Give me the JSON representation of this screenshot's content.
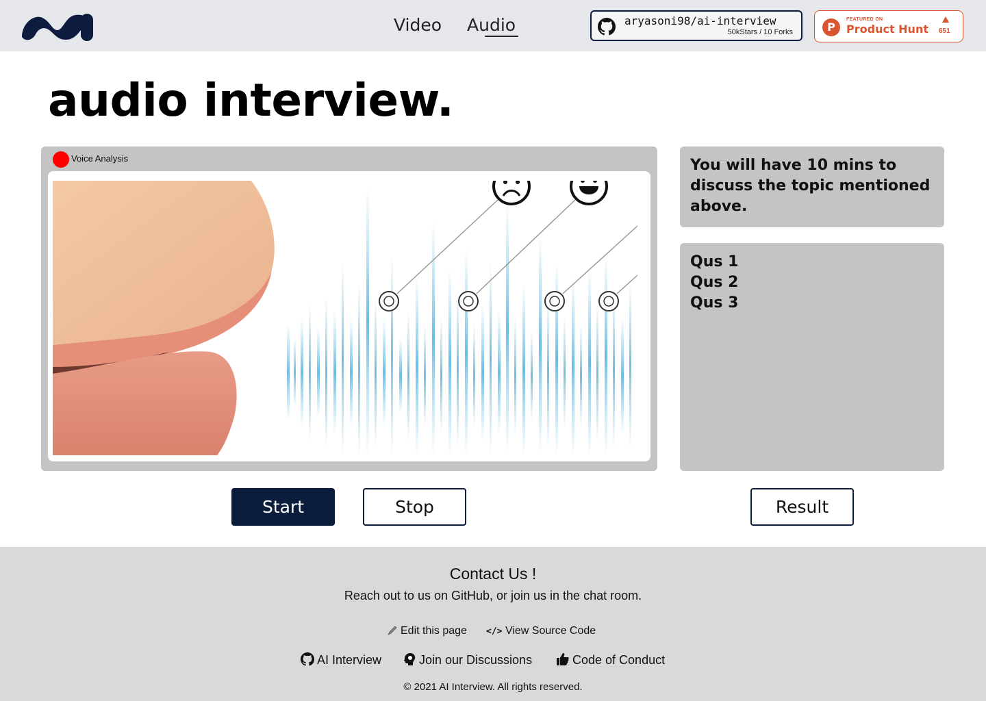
{
  "header": {
    "nav": {
      "video": "Video",
      "audio": "Audio"
    },
    "github_badge": {
      "repo": "aryasoni98/ai-interview",
      "stats": "50kStars / 10 Forks"
    },
    "product_hunt": {
      "featured": "FEATURED ON",
      "name": "Product Hunt",
      "count": "651",
      "brand_color": "#da552f"
    }
  },
  "page": {
    "title": "audio interview."
  },
  "voice_panel": {
    "label": "Voice Analysis",
    "indicator_color": "#ff0000"
  },
  "info_card": {
    "text": "You will have 10 mins to discuss the topic mentioned above."
  },
  "questions": [
    "Qus 1",
    "Qus 2",
    "Qus 3"
  ],
  "buttons": {
    "start": "Start",
    "stop": "Stop",
    "result": "Result"
  },
  "footer": {
    "title": "Contact Us !",
    "subtitle": "Reach out to us on GitHub, or join us in the chat room.",
    "edit": "Edit this page",
    "source_glyph": "</>",
    "source": "View Source Code",
    "links": [
      "AI Interview",
      "Join our Discussions",
      "Code of Conduct"
    ],
    "copyright": "© 2021 AI Interview. All rights reserved."
  },
  "colors": {
    "primary_dark": "#0b1d3a",
    "panel_gray": "#c4c4c4",
    "header_bg": "#e5e7eb",
    "footer_bg": "#d9d9d9"
  }
}
